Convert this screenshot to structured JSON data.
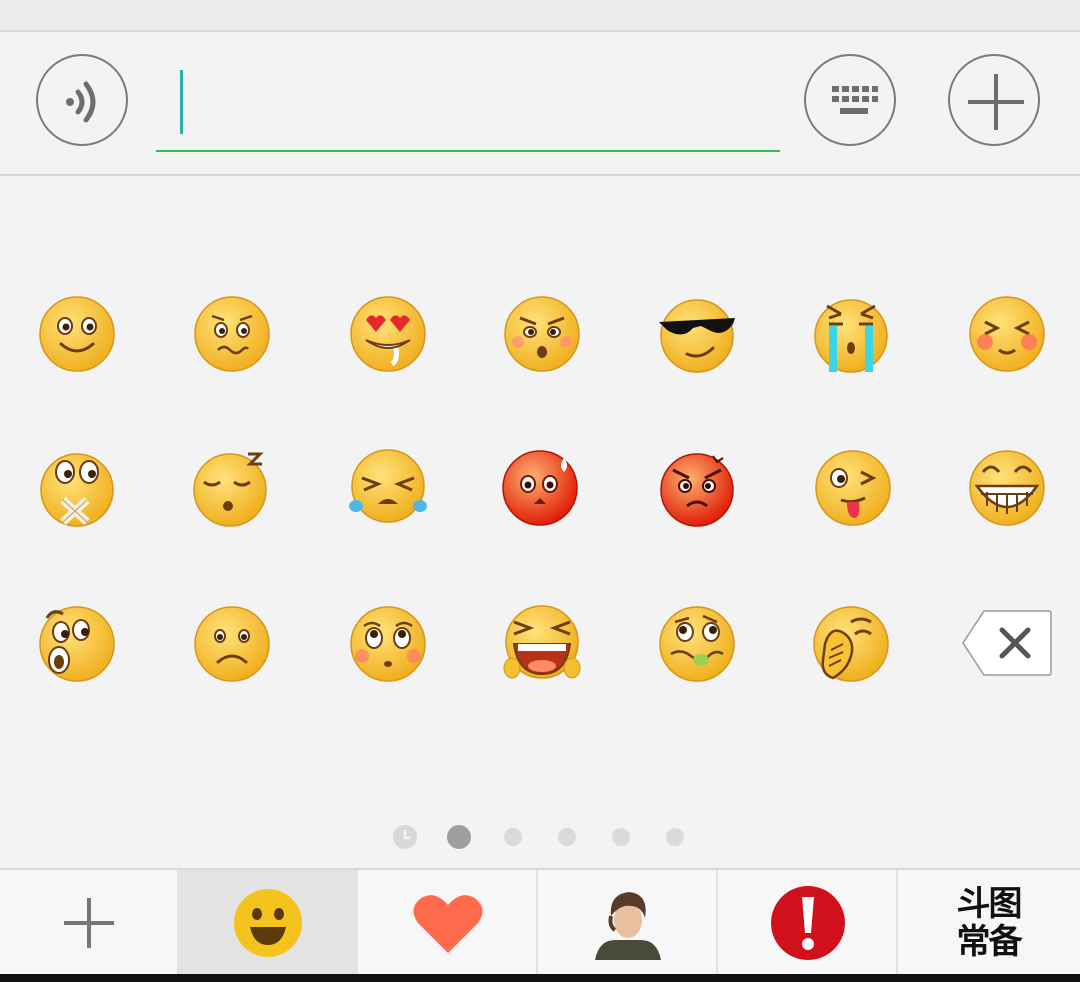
{
  "input_bar": {
    "voice_button": "voice-icon",
    "text_value": "",
    "keyboard_button": "keyboard-icon",
    "more_button": "plus-icon"
  },
  "emoji_panel": {
    "rows": [
      [
        "smile",
        "worried",
        "heart-eyes",
        "angry-shocked",
        "cool-sunglasses",
        "crying",
        "blush"
      ],
      [
        "mouth-taped",
        "sleepy",
        "tears-of-joy",
        "flushed-red",
        "furious-red",
        "tongue-wink",
        "grin"
      ],
      [
        "surprised",
        "frown",
        "pleading",
        "wailing",
        "nauseous",
        "face-palm"
      ]
    ],
    "delete_key": "backspace-icon"
  },
  "page_indicator": {
    "items": [
      "recent",
      "page-1",
      "page-2",
      "page-3",
      "page-4",
      "page-5"
    ],
    "active_index": 1
  },
  "tabbar": {
    "tabs": [
      {
        "name": "add",
        "icon": "plus-icon",
        "selected": false
      },
      {
        "name": "emoji",
        "icon": "smiley-icon",
        "selected": true
      },
      {
        "name": "favorites",
        "icon": "heart-icon",
        "selected": false
      },
      {
        "name": "sticker-pack",
        "icon": "portrait-icon",
        "selected": false
      },
      {
        "name": "alert-pack",
        "icon": "exclamation-icon",
        "selected": false
      },
      {
        "name": "doutu",
        "icon": "text",
        "selected": false,
        "label": "斗图\n常备"
      }
    ],
    "doutu_label": "斗图常备"
  },
  "colors": {
    "accent_green": "#3cb94c",
    "caret": "#27b1a8",
    "emoji_yellow": "#f7c233",
    "heart": "#ff6a4d",
    "alert_red": "#d0101a"
  }
}
